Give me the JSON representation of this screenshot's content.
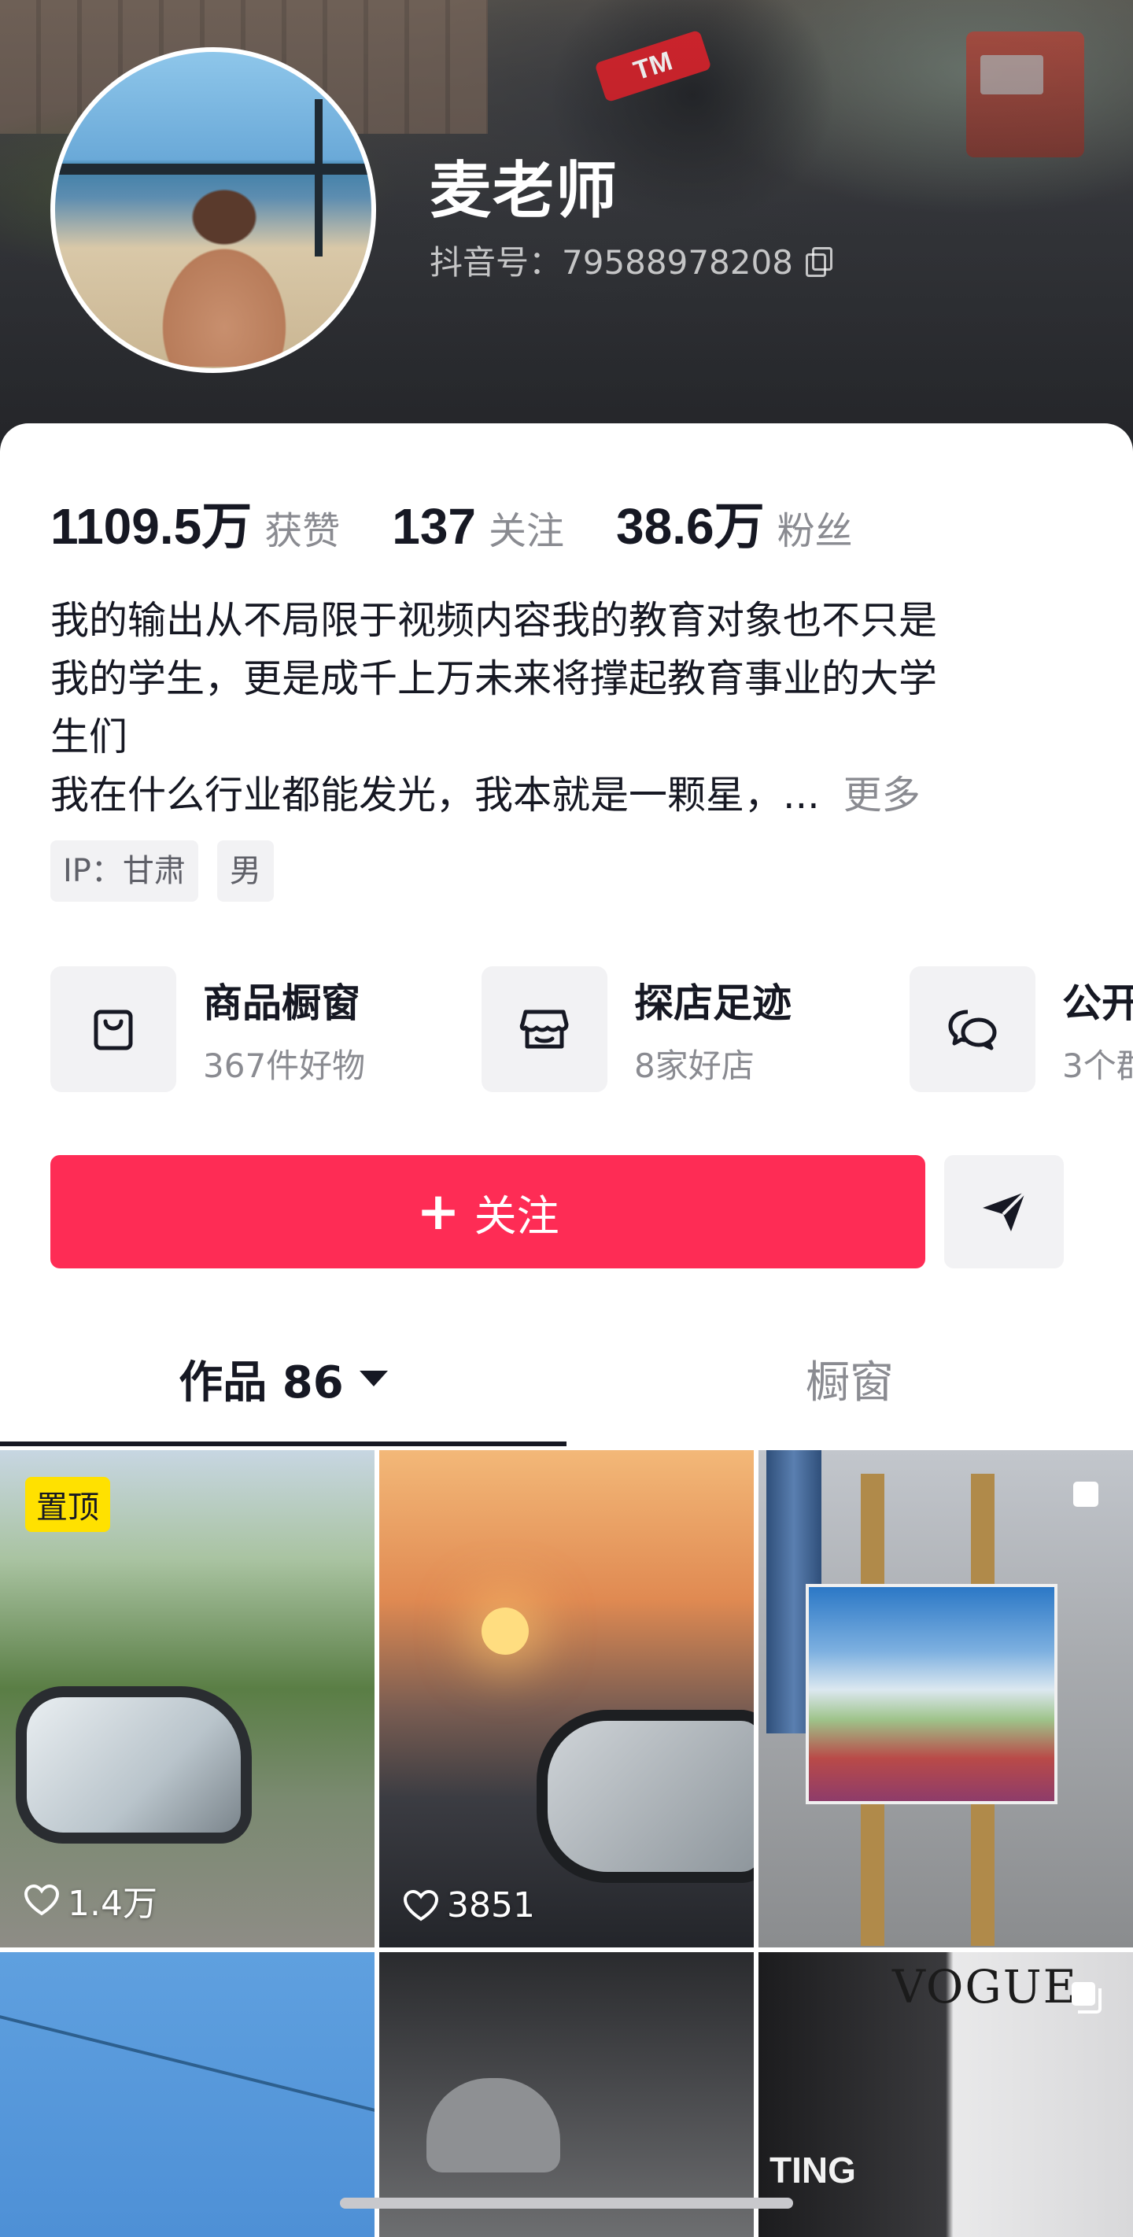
{
  "profile": {
    "name": "麦老师",
    "douyin_id": "抖音号：79588978208",
    "avatar_icon": "avatar-photo",
    "copy_icon": "copy-icon"
  },
  "stats": [
    {
      "value": "1109.5万",
      "label": "获赞"
    },
    {
      "value": "137",
      "label": "关注"
    },
    {
      "value": "38.6万",
      "label": "粉丝"
    }
  ],
  "bio": {
    "lines": [
      "我的输出从不局限于视频内容我的教育对象也不只是",
      "我的学生，更是成千上万未来将撑起教育事业的大学",
      "生们",
      "我在什么行业都能发光，我本就是一颗星，..."
    ],
    "more": "更多"
  },
  "tags": [
    "IP：甘肃",
    "男"
  ],
  "services": [
    {
      "title": "商品橱窗",
      "subtitle": "367件好物",
      "icon": "shopping-bag-icon"
    },
    {
      "title": "探店足迹",
      "subtitle": "8家好店",
      "icon": "store-icon"
    },
    {
      "title": "公开",
      "subtitle": "3个群",
      "icon": "chat-bubbles-icon"
    }
  ],
  "actions": {
    "follow_label": "关注",
    "follow_plus": "+",
    "share_icon": "send-icon"
  },
  "tabs": {
    "works_label": "作品 86",
    "window_label": "橱窗"
  },
  "videos": [
    {
      "pinned_label": "置顶",
      "likes": "1.4万"
    },
    {
      "likes": "3851"
    },
    {
      "multi_image": true
    },
    {},
    {},
    {
      "overlay_text_1": "VOGUE",
      "overlay_text_2": "TING",
      "multi_image": true
    }
  ],
  "colors": {
    "accent": "#fe2c55",
    "pin_badge": "#ffe100",
    "text_primary": "#161823",
    "text_secondary": "#8a8b91",
    "chip_bg": "#f2f2f4"
  }
}
